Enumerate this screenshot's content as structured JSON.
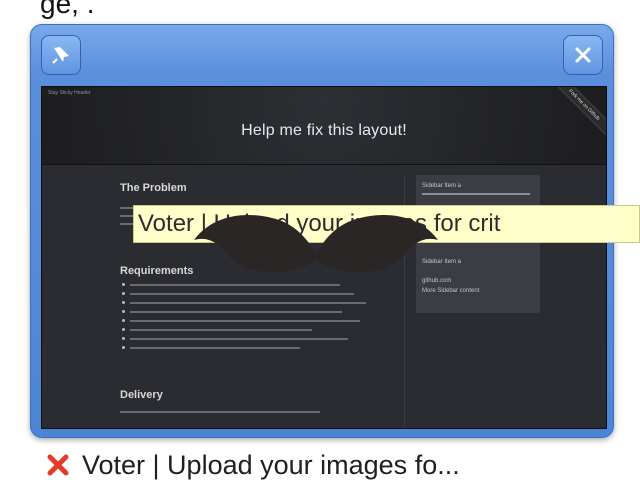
{
  "header_fragment": "ge, .",
  "window": {
    "pin_icon": "pin-icon",
    "close_icon": "close-icon",
    "tiny_tab": "Stay Sticky Header",
    "title": "Help me fix this layout!",
    "ribbon": "Fork me on Github",
    "sections": {
      "problem": "The Problem",
      "requirements": "Requirements",
      "delivery": "Delivery"
    },
    "sidebar": {
      "item1": "Sidebar Item a",
      "item2": "Sidebar Item a",
      "link": "github.com",
      "more": "More Sidebar content"
    }
  },
  "tooltip": {
    "text": "Voter | Upload your images for crit"
  },
  "caption": {
    "text": "Voter | Upload your images fo...",
    "status_icon": "error-x-icon",
    "status_color": "#e43b2a"
  }
}
